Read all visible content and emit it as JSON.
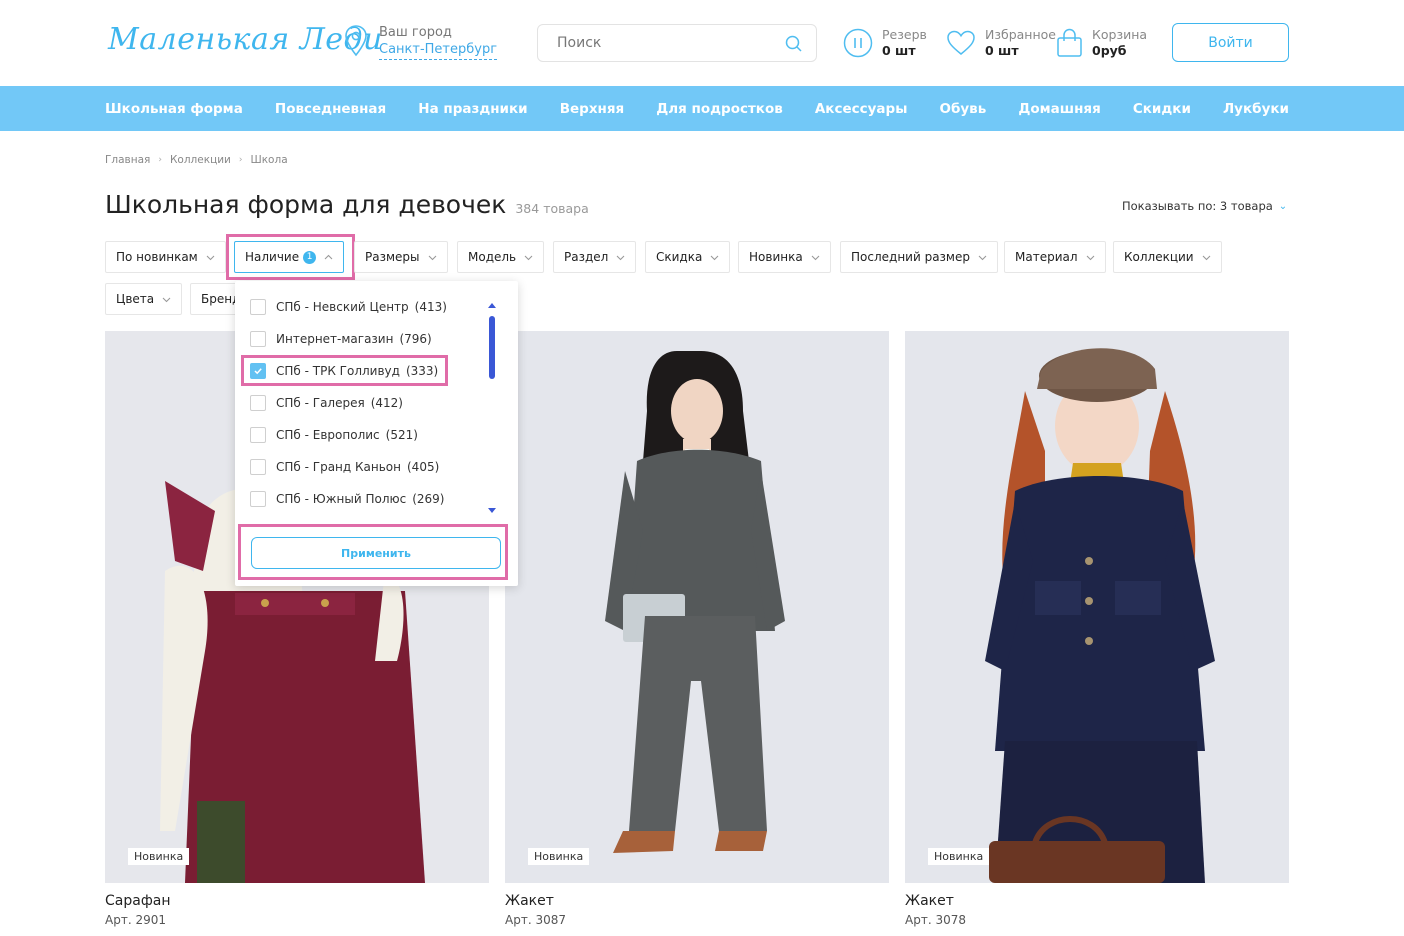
{
  "header": {
    "logo": "Маленькая Леди",
    "city_label": "Ваш город",
    "city_value": "Санкт-Петербург",
    "search_placeholder": "Поиск",
    "reserve": {
      "label": "Резерв",
      "value": "0 шт"
    },
    "favorites": {
      "label": "Избранное",
      "value": "0 шт"
    },
    "cart": {
      "label": "Корзина",
      "value": "0руб"
    },
    "login": "Войти"
  },
  "nav": [
    "Школьная форма",
    "Повседневная",
    "На праздники",
    "Верхняя",
    "Для подростков",
    "Аксессуары",
    "Обувь",
    "Домашняя",
    "Скидки",
    "Лукбуки"
  ],
  "breadcrumb": [
    "Главная",
    "Коллекции",
    "Школа"
  ],
  "page": {
    "title": "Школьная форма для девочек",
    "count": "384 товара",
    "per_page": "Показывать по: 3 товара"
  },
  "filters": {
    "sort": "По новинкам",
    "availability": "Наличие",
    "availability_badge": "1",
    "sizes": "Размеры",
    "model": "Модель",
    "section": "Раздел",
    "discount": "Скидка",
    "novelty": "Новинка",
    "last_size": "Последний размер",
    "material": "Материал",
    "collections": "Коллекции",
    "colors": "Цвета",
    "brand": "Бренд"
  },
  "availability_dropdown": {
    "options": [
      {
        "label": "СПб - Невский Центр",
        "count": "(413)",
        "checked": false
      },
      {
        "label": "Интернет-магазин",
        "count": "(796)",
        "checked": false
      },
      {
        "label": "СПб - ТРК Голливуд",
        "count": "(333)",
        "checked": true
      },
      {
        "label": "СПб - Галерея",
        "count": "(412)",
        "checked": false
      },
      {
        "label": "СПб - Европолис",
        "count": "(521)",
        "checked": false
      },
      {
        "label": "СПб - Гранд Каньон",
        "count": "(405)",
        "checked": false
      },
      {
        "label": "СПб - Южный Полюс",
        "count": "(269)",
        "checked": false
      }
    ],
    "apply": "Применить"
  },
  "products": [
    {
      "badge": "Новинка",
      "name": "Сарафан",
      "art": "Арт. 2901"
    },
    {
      "badge": "Новинка",
      "name": "Жакет",
      "art": "Арт. 3087"
    },
    {
      "badge": "Новинка",
      "name": "Жакет",
      "art": "Арт. 3078"
    }
  ],
  "colors": {
    "accent": "#3fb6ee",
    "nav_bg": "#72c8f7",
    "highlight": "#e06ca8",
    "scrollbar": "#3a57d6"
  }
}
